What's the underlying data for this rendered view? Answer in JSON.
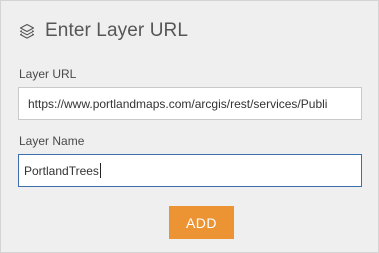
{
  "header": {
    "icon": "layers-icon",
    "title": "Enter Layer URL"
  },
  "form": {
    "url_label": "Layer URL",
    "url_value": "https://www.portlandmaps.com/arcgis/rest/services/Publi",
    "name_label": "Layer Name",
    "name_value": "PortlandTrees"
  },
  "actions": {
    "add_label": "ADD",
    "add_color": "#ec9434"
  },
  "colors": {
    "panel_background": "#efefef",
    "focused_border": "#3b6fb0"
  }
}
